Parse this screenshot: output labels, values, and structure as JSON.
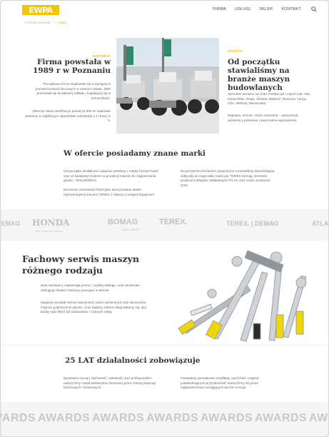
{
  "header": {
    "logo_text": "EWPA",
    "nav": [
      "FIRMA",
      "USŁUGI",
      "SKLEP",
      "KONTAKT"
    ],
    "search_icon": "search-icon"
  },
  "breadcrumb": [
    "STRONA GŁÓWNA",
    "»",
    "FIRMA"
  ],
  "history": {
    "tag": "HISTORIA",
    "title": "Firma powstała w 1989 r w Poznaniu",
    "p1": "Początkowo firma znajdowała się w wynajętych pomieszczeniach biurowych w centrum miasta. 1994 przeniosła się do własnej zakładu, znajdującej się w Komornikach.",
    "p2": "Obecnie nasza siedziba po ponad 10 000 m² ulokowan jesteśmy w najbliższym sąsiedztwie autostrady A 2 i trasy nr 5."
  },
  "offer": {
    "tag": "OFERTA",
    "title": "Od początku stawialiśmy na branże maszyn budowlanych",
    "p1": "Sprzedaż zarówno na rynku Polskim jak i export (UE, Irak, Kazachstan, Rosja, Ukraina, Białoruś, Rumunia, Turcja, USA, Meksyk, Wenezuela).",
    "p2": "Naprawa, remont, części zamienne – autoryzacje, wysokoscy poniesow, nowoczesne wyposażenie."
  },
  "brands_section": {
    "title": "W ofercie posiadamy znane marki",
    "left_p1": "Od początku działalności związani jesteśmy z marką Honda Power oraz ze światowym liderem w produkcji maszyn do zagęszczania gruntu – firmą BOMAG.",
    "left_p2": "Na terenie zachodniej Polski jako autoryzowany dealer reprezentujemy koncern TEREX z zakresu Compact Equipment.",
    "right_p1": "Na przestrzeni lat bardzo dynamiczne rozwinęliśmy dział dźwigów, dołączyły do niego takie marki jak: TEREX Demag, niemiecki producent dźwigów zakładowych ATLAS oraz części producent OXD."
  },
  "brand_logos": [
    "DEMAG",
    "HONDA",
    "The Power of Dreams",
    "BOMAG",
    "FAYAT GROUP",
    "TEREX.",
    "TEREX. | DEMAG",
    "ATLAS"
  ],
  "service": {
    "title": "Fachowy serwis maszyn różnego rodzaju",
    "p1": "Nasi mechanicy zapewniają pomoc i szybką obsługę. Auta serwisowe obsługują również maszyny pracujące w terenie.",
    "p2": "Magazyn posiada szeroki asortyment części zamiennych oraz akcesoriów. Poprzez podnoszenie jakości i oraz większy zakres usług staramy się, aby każdy nasz klient był zadowolony z naszych usług."
  },
  "anniversary": {
    "title": "25 LAT działalności zobowiązuje",
    "left_p": "Dynamika rozwoju, fachowość, rzetelność oraz profesjonalizm naszej firmy został wielokrotnie doceniony przez szereg instytucji branżowych i finansowych.",
    "right_p": "Posiadamy pamiątkowe certyfikaty, wyróżnień i nagród potwierdzających przynależność naszej firmy do grona najdynamiczniej rozwijających się firm w kraju."
  },
  "awards": [
    "AWARDS",
    "AWARDS",
    "AWARDS",
    "AWARDS",
    "AWARDS",
    "AWARDS",
    "AWARDS"
  ],
  "colors": {
    "accent": "#f5c400",
    "text": "#333333",
    "muted": "#666666",
    "logo_gray": "#c0c0c0"
  }
}
